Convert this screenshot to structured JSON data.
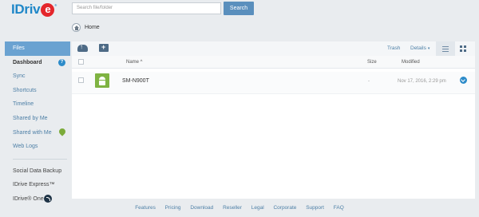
{
  "header": {
    "logo_text": "IDriv",
    "logo_e": "e",
    "logo_tm": "®",
    "search_placeholder": "Search file/folder",
    "search_button": "Search"
  },
  "breadcrumb": {
    "home_label": "Home"
  },
  "sidebar": {
    "items": [
      {
        "label": "Files"
      },
      {
        "label": "Dashboard",
        "badge": "?"
      },
      {
        "label": "Sync"
      },
      {
        "label": "Shortcuts"
      },
      {
        "label": "Timeline"
      },
      {
        "label": "Shared by Me"
      },
      {
        "label": "Shared with Me"
      },
      {
        "label": "Web Logs"
      }
    ],
    "extra": [
      {
        "label": "Social Data Backup"
      },
      {
        "label": "IDrive Express™"
      },
      {
        "label": "IDrive® One"
      }
    ]
  },
  "toolbar": {
    "trash": "Trash",
    "details": "Details",
    "details_caret": "▾"
  },
  "table": {
    "columns": {
      "name": "Name ^",
      "size": "Size",
      "modified": "Modified"
    },
    "rows": [
      {
        "name": "SM-N900T",
        "size": "-",
        "modified": "Nov 17, 2016, 2:29 pm"
      }
    ]
  },
  "footer": {
    "links": [
      "Features",
      "Pricing",
      "Download",
      "Reseller",
      "Legal",
      "Corporate",
      "Support",
      "FAQ"
    ]
  },
  "colors": {
    "accent": "#2c8bc9",
    "sidebar_active": "#6aa2d1",
    "logo_red": "#e4262b"
  }
}
